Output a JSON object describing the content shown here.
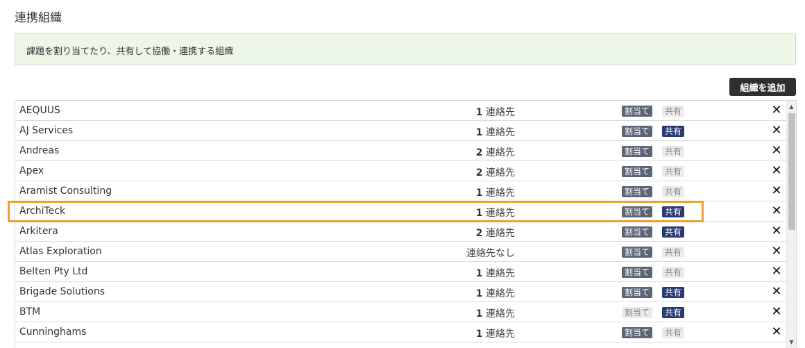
{
  "page": {
    "title": "連携組織",
    "info": "課題を割り当てたり、共有して協働・連携する組織",
    "add_button": "組織を追加"
  },
  "labels": {
    "assign": "割当て",
    "share": "共有",
    "delete": "✕"
  },
  "colors": {
    "assign_active": "#5c6577",
    "share_active": "#2a3a73",
    "inactive": "#ebebeb",
    "highlight": "#f0a030"
  },
  "rows": [
    {
      "name": "AEQUUS",
      "count": "1",
      "contacts": "連絡先",
      "assign": true,
      "share": false
    },
    {
      "name": "AJ Services",
      "count": "1",
      "contacts": "連絡先",
      "assign": true,
      "share": true
    },
    {
      "name": "Andreas",
      "count": "2",
      "contacts": "連絡先",
      "assign": true,
      "share": false
    },
    {
      "name": "Apex",
      "count": "2",
      "contacts": "連絡先",
      "assign": true,
      "share": false
    },
    {
      "name": "Aramist Consulting",
      "count": "1",
      "contacts": "連絡先",
      "assign": true,
      "share": false
    },
    {
      "name": "ArchiTeck",
      "count": "1",
      "contacts": "連絡先",
      "assign": true,
      "share": true,
      "highlighted": true
    },
    {
      "name": "Arkitera",
      "count": "2",
      "contacts": "連絡先",
      "assign": true,
      "share": true
    },
    {
      "name": "Atlas Exploration",
      "count": "",
      "contacts": "連絡先なし",
      "assign": true,
      "share": false
    },
    {
      "name": "Belten Pty Ltd",
      "count": "1",
      "contacts": "連絡先",
      "assign": true,
      "share": false
    },
    {
      "name": "Brigade Solutions",
      "count": "1",
      "contacts": "連絡先",
      "assign": true,
      "share": true
    },
    {
      "name": "BTM",
      "count": "1",
      "contacts": "連絡先",
      "assign": false,
      "share": true
    },
    {
      "name": "Cunninghams",
      "count": "1",
      "contacts": "連絡先",
      "assign": true,
      "share": false
    }
  ]
}
